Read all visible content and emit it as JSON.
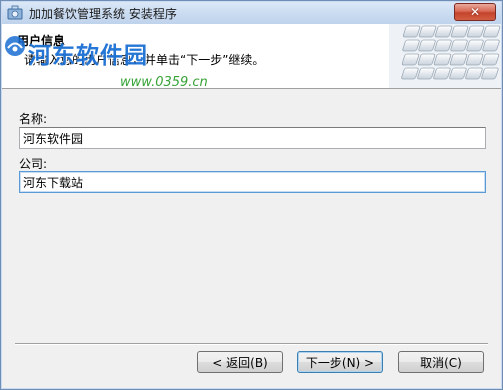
{
  "window": {
    "title": "加加餐饮管理系统 安装程序",
    "close_label": "✕"
  },
  "header": {
    "title": "用户信息",
    "description": "请输入您的用户信息，并单击“下一步”继续。"
  },
  "watermark": {
    "text": "河东软件园",
    "url": "www.0359.cn"
  },
  "form": {
    "name_label": "名称:",
    "name_value": "河东软件园",
    "company_label": "公司:",
    "company_value": "河东下载站"
  },
  "buttons": {
    "back": "< 返回(B)",
    "next": "下一步(N) >",
    "cancel": "取消(C)"
  },
  "colors": {
    "accent": "#3c7fb1",
    "watermark_blue": "#1a6fd3",
    "watermark_green": "#37a337",
    "close_red": "#c4442c"
  }
}
